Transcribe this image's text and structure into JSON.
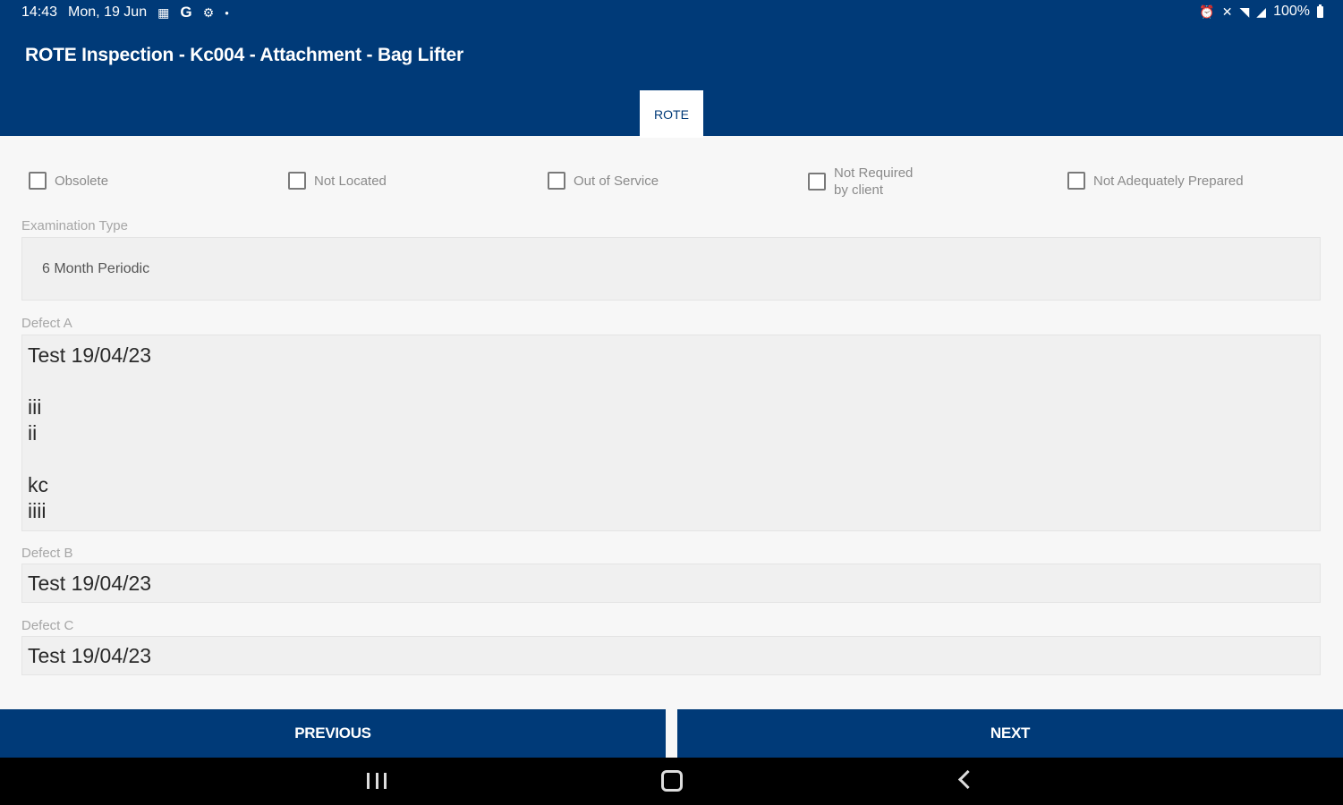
{
  "status_bar": {
    "time": "14:43",
    "date": "Mon, 19 Jun",
    "battery": "100%",
    "icons_left": [
      "calendar-icon",
      "google-icon",
      "settings-icon",
      "dot-icon"
    ],
    "icons_right": [
      "alarm-icon",
      "mute-icon",
      "wifi-icon",
      "signal-icon",
      "battery-icon"
    ]
  },
  "app": {
    "title": "ROTE Inspection - Kc004 - Attachment - Bag Lifter",
    "tab_label": "ROTE"
  },
  "checkboxes": [
    {
      "label": "Obsolete",
      "checked": false
    },
    {
      "label": "Not Located",
      "checked": false
    },
    {
      "label": "Out of Service",
      "checked": false
    },
    {
      "label": "Not Required\nby client",
      "checked": false
    },
    {
      "label": "Not Adequately Prepared",
      "checked": false
    }
  ],
  "form": {
    "exam_type_label": "Examination Type",
    "exam_type_value": "6 Month Periodic",
    "defect_a_label": "Defect A",
    "defect_a_value": "Test 19/04/23\n\niii\nii\n\nkc\niiii",
    "defect_b_label": "Defect B",
    "defect_b_value": "Test 19/04/23",
    "defect_c_label": "Defect C",
    "defect_c_value": "Test 19/04/23"
  },
  "buttons": {
    "previous": "PREVIOUS",
    "next": "NEXT"
  },
  "colors": {
    "primary": "#003a78",
    "background": "#f7f7f7",
    "field": "#f0f0f0"
  }
}
